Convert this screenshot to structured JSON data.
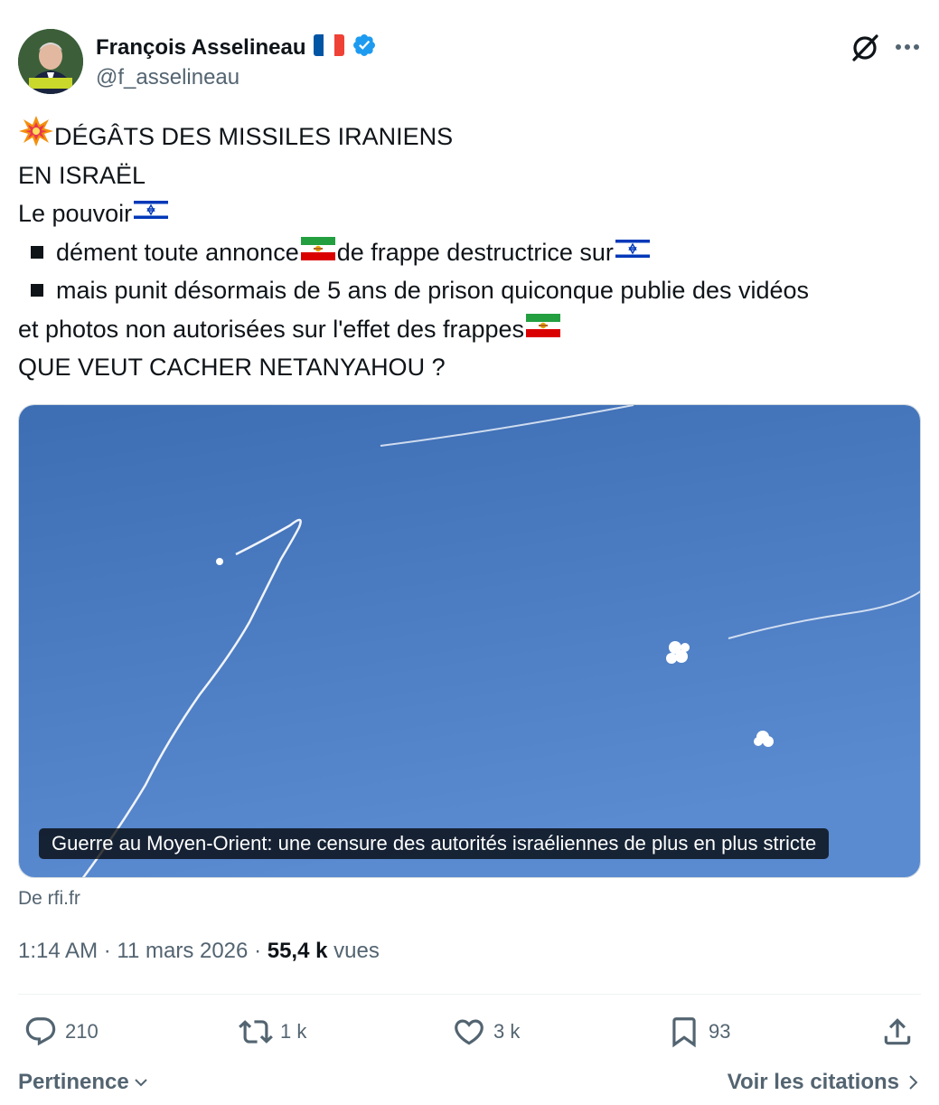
{
  "author": {
    "name": "François Asselineau",
    "handle": "@f_asselineau",
    "avatar_badge": "ASSELINEAU 2027",
    "verified": true
  },
  "tweet": {
    "line1": "DÉGÂTS DES MISSILES IRANIENS",
    "line2": "EN ISRAËL",
    "line3": "Le pouvoir",
    "bullet1_a": "dément toute annonce",
    "bullet1_b": "de frappe destructrice sur",
    "bullet2": "mais punit désormais de 5 ans de prison quiconque publie des vidéos",
    "line4": "et photos non autorisées sur l'effet des frappes",
    "line5": "QUE VEUT CACHER NETANYAHOU ?"
  },
  "card": {
    "caption": "Guerre au Moyen-Orient: une censure des autorités israéliennes de plus en plus stricte",
    "source": "De rfi.fr"
  },
  "meta": {
    "time": "1:14 AM",
    "date": "11 mars 2026",
    "views_count": "55,4 k",
    "views_label": "vues"
  },
  "actions": {
    "replies": "210",
    "reposts": "1 k",
    "likes": "3 k",
    "bookmarks": "93"
  },
  "footer": {
    "sort_label": "Pertinence",
    "quotes_label": "Voir les citations"
  },
  "colors": {
    "text": "#0f1419",
    "secondary": "#536471",
    "verified": "#1d9bf0",
    "sky": "#4a7cc4"
  }
}
